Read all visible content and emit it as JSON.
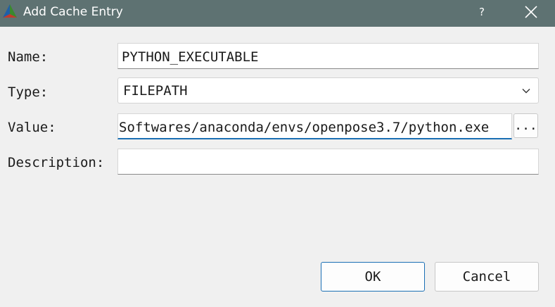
{
  "window": {
    "title": "Add Cache Entry",
    "help_label": "?"
  },
  "form": {
    "name_label": "Name:",
    "name_value": "PYTHON_EXECUTABLE",
    "type_label": "Type:",
    "type_value": "FILEPATH",
    "value_label": "Value:",
    "value_value": "Softwares/anaconda/envs/openpose3.7/python.exe",
    "browse_label": "...",
    "description_label": "Description:",
    "description_value": ""
  },
  "buttons": {
    "ok_label": "OK",
    "cancel_label": "Cancel"
  },
  "colors": {
    "titlebar": "#5e7272",
    "focus_accent": "#1a6fb4"
  },
  "icons": {
    "app": "cmake-triangle-icon",
    "close": "close-icon",
    "dropdown": "chevron-down-icon"
  }
}
